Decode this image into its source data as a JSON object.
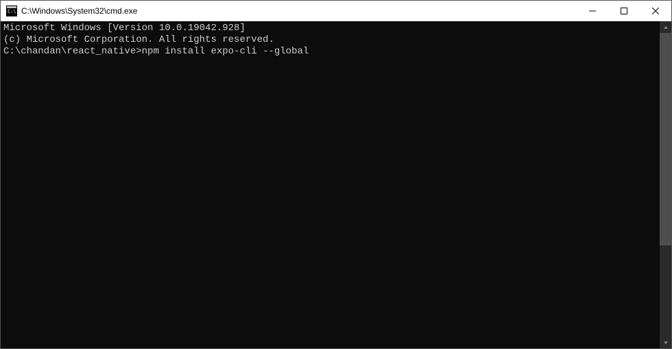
{
  "window": {
    "title": "C:\\Windows\\System32\\cmd.exe"
  },
  "terminal": {
    "line1": "Microsoft Windows [Version 10.0.19042.928]",
    "line2": "(c) Microsoft Corporation. All rights reserved.",
    "line3": "",
    "prompt": "C:\\chandan\\react_native>",
    "command": "npm install expo-cli --global"
  }
}
